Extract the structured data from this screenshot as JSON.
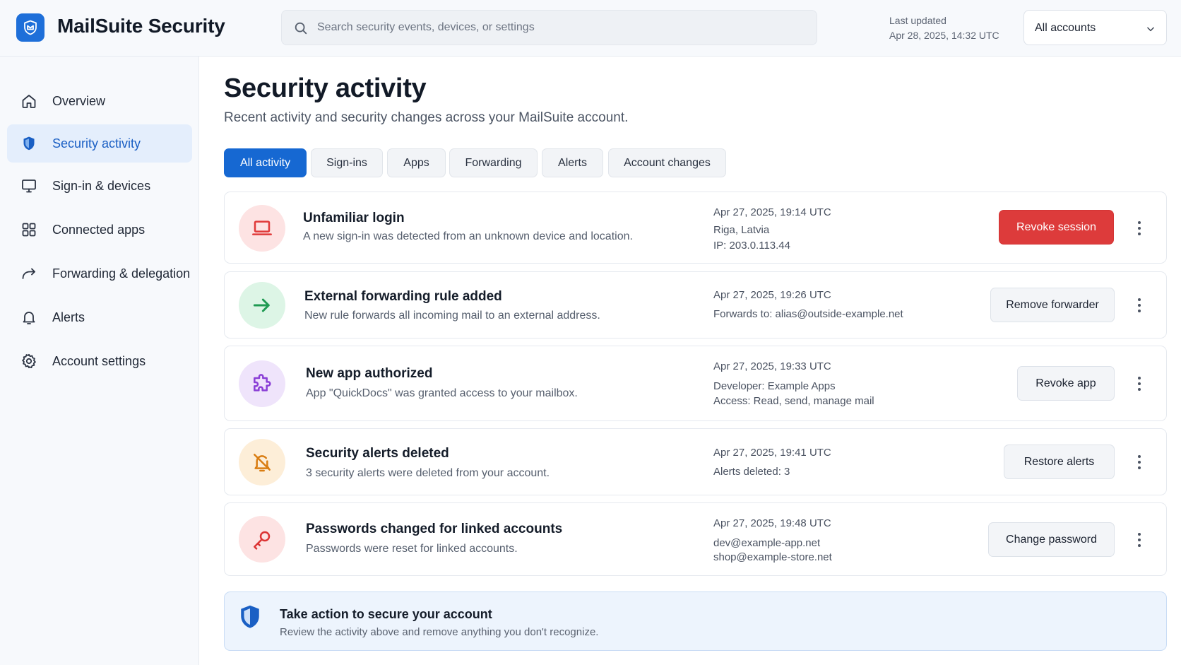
{
  "app": {
    "title": "MailSuite Security"
  },
  "search": {
    "placeholder": "Search security events, devices, or settings"
  },
  "header": {
    "updated_label": "Last updated",
    "updated_time": "Apr 28, 2025, 14:32 UTC",
    "account_selector": "All accounts"
  },
  "sidebar": {
    "items": [
      {
        "label": "Overview",
        "icon": "home-icon"
      },
      {
        "label": "Security activity",
        "icon": "shield-icon",
        "active": true
      },
      {
        "label": "Sign-in & devices",
        "icon": "monitor-icon"
      },
      {
        "label": "Connected apps",
        "icon": "grid-icon"
      },
      {
        "label": "Forwarding & delegation",
        "icon": "forward-arrow-icon"
      },
      {
        "label": "Alerts",
        "icon": "bell-icon"
      },
      {
        "label": "Account settings",
        "icon": "gear-icon"
      }
    ]
  },
  "main": {
    "title": "Security activity",
    "subtitle": "Recent activity and security changes across your MailSuite account.",
    "tabs": [
      {
        "label": "All activity",
        "active": true
      },
      {
        "label": "Sign-ins"
      },
      {
        "label": "Apps"
      },
      {
        "label": "Forwarding"
      },
      {
        "label": "Alerts"
      },
      {
        "label": "Account changes"
      }
    ],
    "events": [
      {
        "title": "Unfamiliar login",
        "description": "A new sign-in was detected from an unknown device and location.",
        "time": "Apr 27, 2025, 19:14 UTC",
        "details": [
          "Riga, Latvia",
          "IP: 203.0.113.44"
        ],
        "action": "Revoke session",
        "icon": "laptop-icon",
        "icon_color": "#e03a3a",
        "icon_bg": "#fde3e3"
      },
      {
        "title": "External forwarding rule added",
        "description": "New rule forwards all incoming mail to an external address.",
        "time": "Apr 27, 2025, 19:26 UTC",
        "details": [
          "Forwards to: alias@outside-example.net"
        ],
        "action": "Remove forwarder",
        "icon": "arrow-right-icon",
        "icon_color": "#1f9a52",
        "icon_bg": "#ddf5e6"
      },
      {
        "title": "New app authorized",
        "description": "App \"QuickDocs\" was granted access to your mailbox.",
        "time": "Apr 27, 2025, 19:33 UTC",
        "details": [
          "Developer: Example Apps",
          "Access: Read, send, manage mail"
        ],
        "action": "Revoke app",
        "icon": "puzzle-icon",
        "icon_color": "#8a3fd6",
        "icon_bg": "#efe4fb"
      },
      {
        "title": "Security alerts deleted",
        "description": "3 security alerts were deleted from your account.",
        "time": "Apr 27, 2025, 19:41 UTC",
        "details": [
          "Alerts deleted: 3"
        ],
        "action": "Restore alerts",
        "icon": "bell-off-icon",
        "icon_color": "#d97d12",
        "icon_bg": "#fdeed8"
      },
      {
        "title": "Passwords changed for linked accounts",
        "description": "Passwords were reset for linked accounts.",
        "time": "Apr 27, 2025, 19:48 UTC",
        "details": [
          "dev@example-app.net",
          "shop@example-store.net"
        ],
        "action": "Change password",
        "icon": "key-icon",
        "icon_color": "#dc3434",
        "icon_bg": "#fde3e3"
      }
    ]
  },
  "banner": {
    "title": "Take action to secure your account",
    "description": "Review the activity above and remove anything you don't recognize."
  },
  "colors": {
    "accent": "#1668d2",
    "danger": "#dd3b3b"
  }
}
